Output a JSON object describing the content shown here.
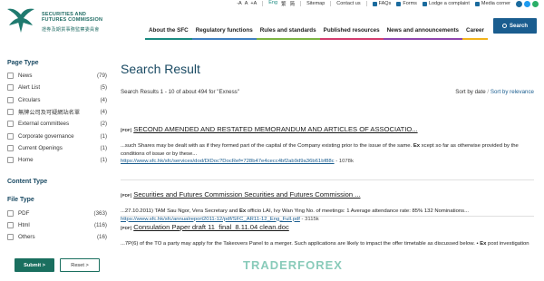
{
  "header": {
    "logo_en_line1": "SECURITIES AND",
    "logo_en_line2": "FUTURES COMMISSION",
    "logo_zh": "證券及期貨事務監察委員會",
    "font_sizes": [
      "-A",
      "A",
      "+A"
    ],
    "languages": [
      "Eng",
      "繁",
      "简"
    ],
    "links": [
      "Sitemap",
      "Contact us"
    ],
    "tools": [
      "FAQs",
      "Forms",
      "Lodge a complaint",
      "Media corner"
    ],
    "social_icons": [
      "facebook-icon",
      "twitter-icon",
      "wechat-icon"
    ],
    "search_button": "Search",
    "nav": [
      "About the SFC",
      "Regulatory functions",
      "Rules and standards",
      "Published resources",
      "News and announcements",
      "Career"
    ],
    "nav_colors": [
      "#1a8a80",
      "#3f7fbf",
      "#7cb342",
      "#d23c6e",
      "#8e44ad",
      "#f2b31b"
    ]
  },
  "sidebar": {
    "page_type": {
      "heading": "Page Type",
      "items": [
        {
          "label": "News",
          "count": "(79)"
        },
        {
          "label": "Alert List",
          "count": "(5)"
        },
        {
          "label": "Circulars",
          "count": "(4)"
        },
        {
          "label": "無牌公司及可疑網站名單",
          "count": "(4)"
        },
        {
          "label": "External committees",
          "count": "(2)"
        },
        {
          "label": "Corporate governance",
          "count": "(1)"
        },
        {
          "label": "Current Openings",
          "count": "(1)"
        },
        {
          "label": "Home",
          "count": "(1)"
        }
      ]
    },
    "content_type": {
      "heading": "Content Type"
    },
    "file_type": {
      "heading": "File Type",
      "items": [
        {
          "label": "PDF",
          "count": "(363)"
        },
        {
          "label": "Html",
          "count": "(116)"
        },
        {
          "label": "Others",
          "count": "(16)"
        }
      ]
    },
    "submit_label": "Submit >",
    "reset_label": "Reset >"
  },
  "main": {
    "title": "Search Result",
    "summary": "Search Results 1 - 10 of about 494 for \"Exness\"",
    "sort_by_date": "Sort by date",
    "sort_separator": "/",
    "sort_by_relevance": "Sort by relevance",
    "results": [
      {
        "tag": "[PDF]",
        "title": "SECOND AMENDED AND RESTATED MEMORANDUM AND ARTICLES OF ASSOCIATIO...",
        "snippet_before": "...such Shares may be dealt with as if they formed part of the capital of the Company existing prior to the issue of the same. ",
        "snippet_bold": "Ex",
        "snippet_after": " xcept so far as otherwise provided by the conditions of issue or by these...",
        "url": "https://www.sfc.hk/sfc/services/dod/DIDoc?DocRef=728b47e4cecc4bf2ab9d9a36b61bf88c",
        "size": " - 1078k"
      },
      {
        "tag": "[PDF]",
        "title": "Securities and Futures Commission Securities and Futures Commission ...",
        "snippet_before": "...27.10.2011) TAM Sau Ngor, Vera Secretary and ",
        "snippet_bold": "Ex",
        "snippet_after": " officio LAI, Ivy Wan Ying No. of meetings: 1 Average attendance rate: 85% 132 Nominations...",
        "url": "https://www.sfc.hk/sfc/annualreport2011-12/pdf/SFC_AR11-12_Eng_Full.pdf",
        "size": " - 3115k"
      },
      {
        "tag": "[PDF]",
        "title": "Consulation Paper draft 11_final_8.11.04 clean.doc",
        "snippet_before": "...7P(6) of the TO a party may apply for the Takeovers Panel to a merger. Such applications are likely to impact the offer timetable as discussed below. • ",
        "snippet_bold": "Ex",
        "snippet_after": " post investigation"
      }
    ]
  },
  "watermark": "TRADERFOREX"
}
